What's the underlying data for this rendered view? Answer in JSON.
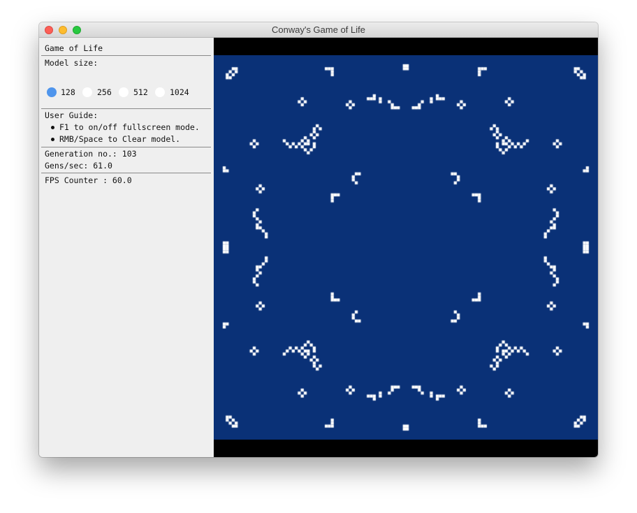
{
  "window": {
    "title": "Conway's Game of Life"
  },
  "sidebar": {
    "heading": "Game of Life",
    "model_size_label": "Model size:",
    "model_sizes": [
      "128",
      "256",
      "512",
      "1024"
    ],
    "selected_model_size": "128",
    "user_guide_label": "User Guide:",
    "guide_items": [
      "F1 to on/off fullscreen mode.",
      "RMB/Space to Clear model."
    ],
    "generation": "Generation no.: 103",
    "gens_per_sec": "Gens/sec: 61.0",
    "fps": "FPS Counter : 60.0"
  },
  "colors": {
    "board_background": "#0a3177",
    "live_cell": "#ffffff",
    "letterbox": "#000000",
    "radio_selected": "#4f95ec"
  },
  "board": {
    "size": 128,
    "view_width": 550,
    "view_height": 550,
    "cells": []
  }
}
